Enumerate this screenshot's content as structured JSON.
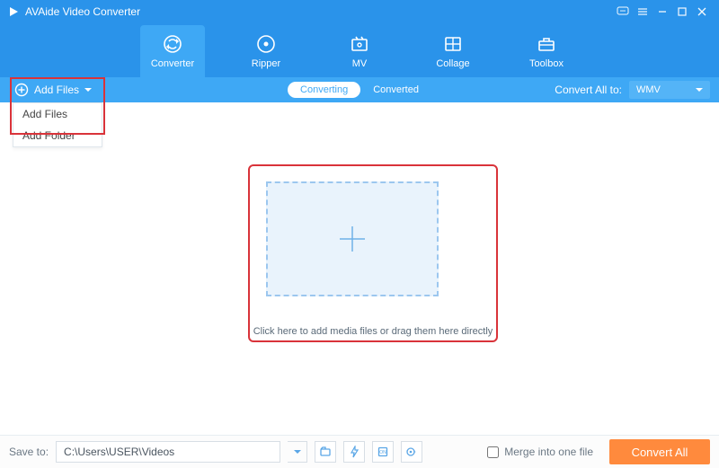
{
  "titlebar": {
    "title": "AVAide Video Converter"
  },
  "tabs": [
    {
      "label": "Converter",
      "icon": "converter-icon"
    },
    {
      "label": "Ripper",
      "icon": "ripper-icon"
    },
    {
      "label": "MV",
      "icon": "mv-icon"
    },
    {
      "label": "Collage",
      "icon": "collage-icon"
    },
    {
      "label": "Toolbox",
      "icon": "toolbox-icon"
    }
  ],
  "subbar": {
    "add_files_label": "Add Files",
    "tabs": {
      "converting": "Converting",
      "converted": "Converted"
    },
    "convert_all_to_label": "Convert All to:",
    "selected_format": "WMV"
  },
  "dropdown": {
    "items": [
      {
        "label": "Add Files"
      },
      {
        "label": "Add Folder"
      }
    ]
  },
  "workspace": {
    "drop_text": "Click here to add media files or drag them here directly"
  },
  "bottombar": {
    "save_to_label": "Save to:",
    "path_value": "C:\\Users\\USER\\Videos",
    "merge_label": "Merge into one file",
    "convert_all_label": "Convert All"
  }
}
